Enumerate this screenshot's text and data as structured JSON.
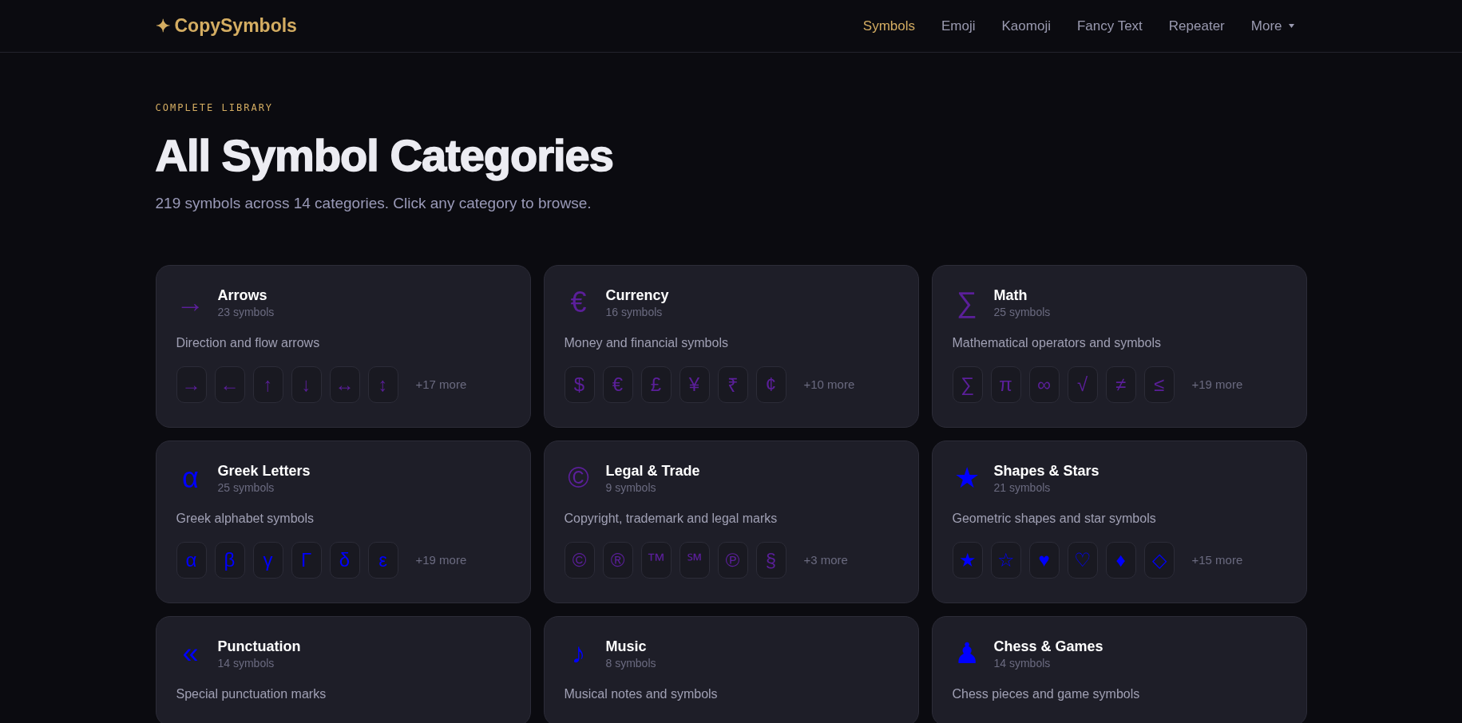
{
  "header": {
    "logo": {
      "mark": "✦",
      "name": "CopySymbols"
    },
    "nav": [
      {
        "label": "Symbols",
        "selected": true
      },
      {
        "label": "Emoji",
        "selected": false
      },
      {
        "label": "Kaomoji",
        "selected": false
      },
      {
        "label": "Fancy Text",
        "selected": false
      },
      {
        "label": "Repeater",
        "selected": false
      },
      {
        "label": "More",
        "selected": false,
        "dropdown": true
      }
    ]
  },
  "hero": {
    "eyebrow": "COMPLETE LIBRARY",
    "title": "All Symbol Categories",
    "subtitle": "219 symbols across 14 categories. Click any category to browse."
  },
  "categories": [
    {
      "icon": "→",
      "color": "#5b1f9a",
      "name": "Arrows",
      "count": "23 symbols",
      "description": "Direction and flow arrows",
      "symbols": [
        "→",
        "←",
        "↑",
        "↓",
        "↔",
        "↕"
      ],
      "more": "+17 more"
    },
    {
      "icon": "€",
      "color": "#5b1f9a",
      "name": "Currency",
      "count": "16 symbols",
      "description": "Money and financial symbols",
      "symbols": [
        "$",
        "€",
        "£",
        "¥",
        "₹",
        "¢"
      ],
      "more": "+10 more"
    },
    {
      "icon": "∑",
      "color": "#5b1f9a",
      "name": "Math",
      "count": "25 symbols",
      "description": "Mathematical operators and symbols",
      "symbols": [
        "∑",
        "π",
        "∞",
        "√",
        "≠",
        "≤"
      ],
      "more": "+19 more"
    },
    {
      "icon": "α",
      "color": "#0000ff",
      "name": "Greek Letters",
      "count": "25 symbols",
      "description": "Greek alphabet symbols",
      "symbols": [
        "α",
        "β",
        "γ",
        "Γ",
        "δ",
        "ε"
      ],
      "more": "+19 more"
    },
    {
      "icon": "©",
      "color": "#5b1f9a",
      "name": "Legal & Trade",
      "count": "9 symbols",
      "description": "Copyright, trademark and legal marks",
      "symbols": [
        "©",
        "®",
        "™",
        "℠",
        "℗",
        "§"
      ],
      "more": "+3 more"
    },
    {
      "icon": "★",
      "color": "#0000ff",
      "name": "Shapes & Stars",
      "count": "21 symbols",
      "description": "Geometric shapes and star symbols",
      "symbols": [
        "★",
        "☆",
        "♥",
        "♡",
        "♦",
        "◇"
      ],
      "more": "+15 more"
    },
    {
      "icon": "«",
      "color": "#0000ff",
      "name": "Punctuation",
      "count": "14 symbols",
      "description": "Special punctuation marks"
    },
    {
      "icon": "♪",
      "color": "#0000ff",
      "name": "Music",
      "count": "8 symbols",
      "description": "Musical notes and symbols"
    },
    {
      "icon": "♟",
      "color": "#0000ff",
      "name": "Chess & Games",
      "count": "14 symbols",
      "description": "Chess pieces and game symbols"
    }
  ]
}
